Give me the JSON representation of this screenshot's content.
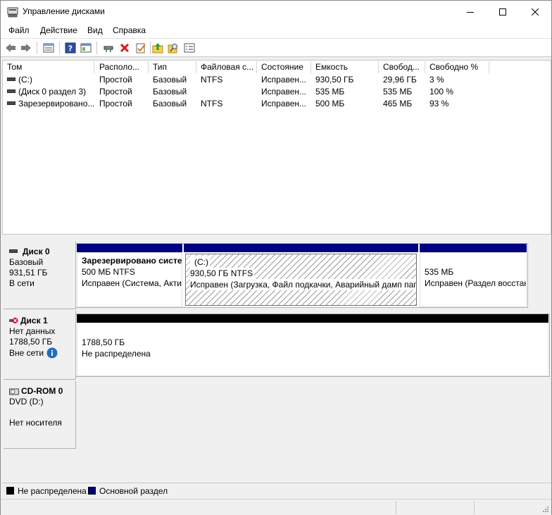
{
  "window": {
    "title": "Управление дисками"
  },
  "menu": {
    "file": "Файл",
    "action": "Действие",
    "view": "Вид",
    "help": "Справка"
  },
  "icons": {
    "back": "back-arrow-icon",
    "forward": "forward-arrow-icon",
    "properties": "properties-icon",
    "help": "help-icon",
    "show_pane": "show-pane-icon",
    "connect": "connect-drive-icon",
    "delete": "delete-icon",
    "check": "check-icon",
    "folder_up": "folder-up-icon",
    "search": "search-icon",
    "options": "options-icon"
  },
  "colors": {
    "primary_partition": "#000080",
    "unallocated": "#000000",
    "accent_info": "#1f6fc1",
    "error_red": "#c8001e"
  },
  "volume_list": {
    "columns": [
      "Том",
      "Располо...",
      "Тип",
      "Файловая с...",
      "Состояние",
      "Емкость",
      "Свобод...",
      "Свободно %"
    ],
    "rows": [
      [
        "(C:)",
        "Простой",
        "Базовый",
        "NTFS",
        "Исправен...",
        "930,50 ГБ",
        "29,96 ГБ",
        "3 %"
      ],
      [
        "(Диск 0 раздел 3)",
        "Простой",
        "Базовый",
        "",
        "Исправен...",
        "535 МБ",
        "535 МБ",
        "100 %"
      ],
      [
        "Зарезервировано...",
        "Простой",
        "Базовый",
        "NTFS",
        "Исправен...",
        "500 МБ",
        "465 МБ",
        "93 %"
      ]
    ]
  },
  "disks": {
    "disk0": {
      "name": "Диск 0",
      "type": "Базовый",
      "size": "931,51 ГБ",
      "status": "В сети",
      "partitions": [
        {
          "title": "Зарезервировано систе",
          "size": "500 МБ NTFS",
          "status": "Исправен (Система, Акти"
        },
        {
          "title": "(C:)",
          "size": "930,50 ГБ NTFS",
          "status": "Исправен (Загрузка, Файл подкачки, Аварийный дамп пап"
        },
        {
          "title": "",
          "size": "535 МБ",
          "status": "Исправен (Раздел восстан"
        }
      ]
    },
    "disk1": {
      "name": "Диск 1",
      "type": "Нет данных",
      "size": "1788,50 ГБ",
      "status": "Вне сети",
      "partitions": [
        {
          "size": "1788,50 ГБ",
          "status": "Не распределена"
        }
      ]
    },
    "cdrom0": {
      "name": "CD-ROM 0",
      "type": "DVD (D:)",
      "status": "Нет носителя"
    }
  },
  "legend": {
    "unallocated": "Не распределена",
    "primary": "Основной раздел"
  }
}
